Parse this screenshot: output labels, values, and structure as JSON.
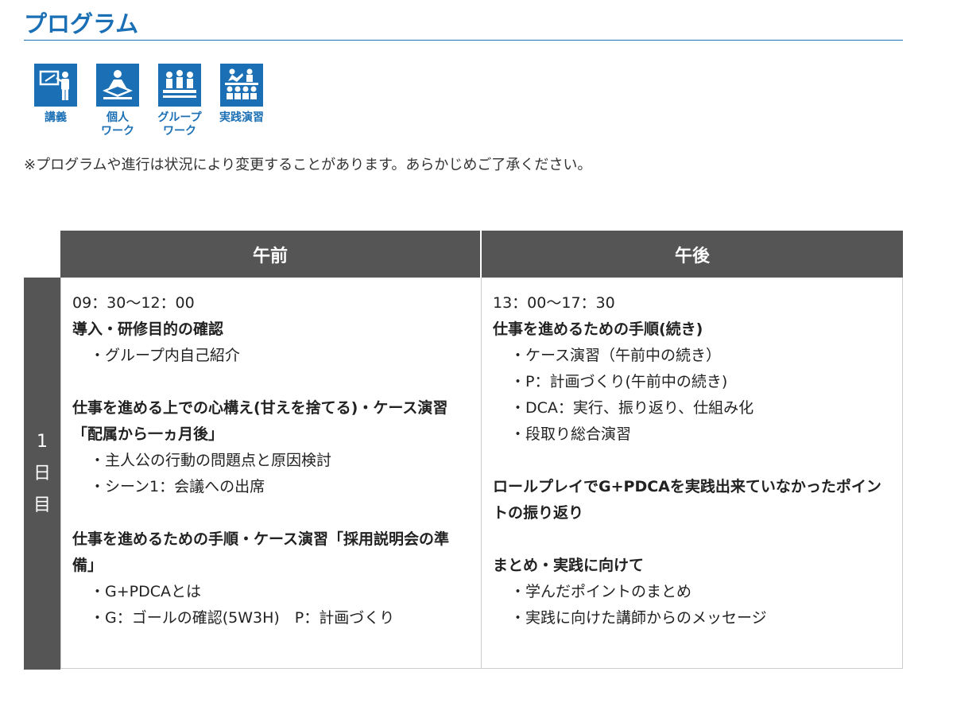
{
  "page": {
    "title": "プログラム"
  },
  "legend": [
    {
      "icon": "lecture-icon",
      "label": "講義"
    },
    {
      "icon": "individual-work-icon",
      "label": "個人\nワーク"
    },
    {
      "icon": "group-work-icon",
      "label": "グループ\nワーク"
    },
    {
      "icon": "practice-icon",
      "label": "実践演習"
    }
  ],
  "note": "※プログラムや進行は状況により変更することがあります。あらかじめご了承ください。",
  "schedule": {
    "headers": {
      "am": "午前",
      "pm": "午後"
    },
    "day_label": [
      "1",
      "日",
      "目"
    ],
    "am": {
      "time": "09：30〜12：00",
      "blocks": [
        {
          "heading": "導入・研修目的の確認",
          "items": [
            "・グループ内自己紹介"
          ]
        },
        {
          "heading": "仕事を進める上での心構え(甘えを捨てる)・ケース演習「配属から一ヵ月後」",
          "items": [
            "・主人公の行動の問題点と原因検討",
            "・シーン1：会議への出席"
          ]
        },
        {
          "heading": "仕事を進めるための手順・ケース演習「採用説明会の準備」",
          "items": [
            "・G+PDCAとは",
            "・G：ゴールの確認(5W3H)　P：計画づくり"
          ]
        }
      ]
    },
    "pm": {
      "time": "13：00〜17：30",
      "blocks": [
        {
          "heading": "仕事を進めるための手順(続き)",
          "items": [
            "・ケース演習（午前中の続き）",
            "・P：計画づくり(午前中の続き)",
            "・DCA：実行、振り返り、仕組み化",
            "・段取り総合演習"
          ]
        },
        {
          "heading": "ロールプレイでG+PDCAを実践出来ていなかったポイントの振り返り",
          "items": []
        },
        {
          "heading": "まとめ・実践に向けて",
          "items": [
            "・学んだポイントのまとめ",
            "・実践に向けた講師からのメッセージ"
          ]
        }
      ]
    }
  }
}
